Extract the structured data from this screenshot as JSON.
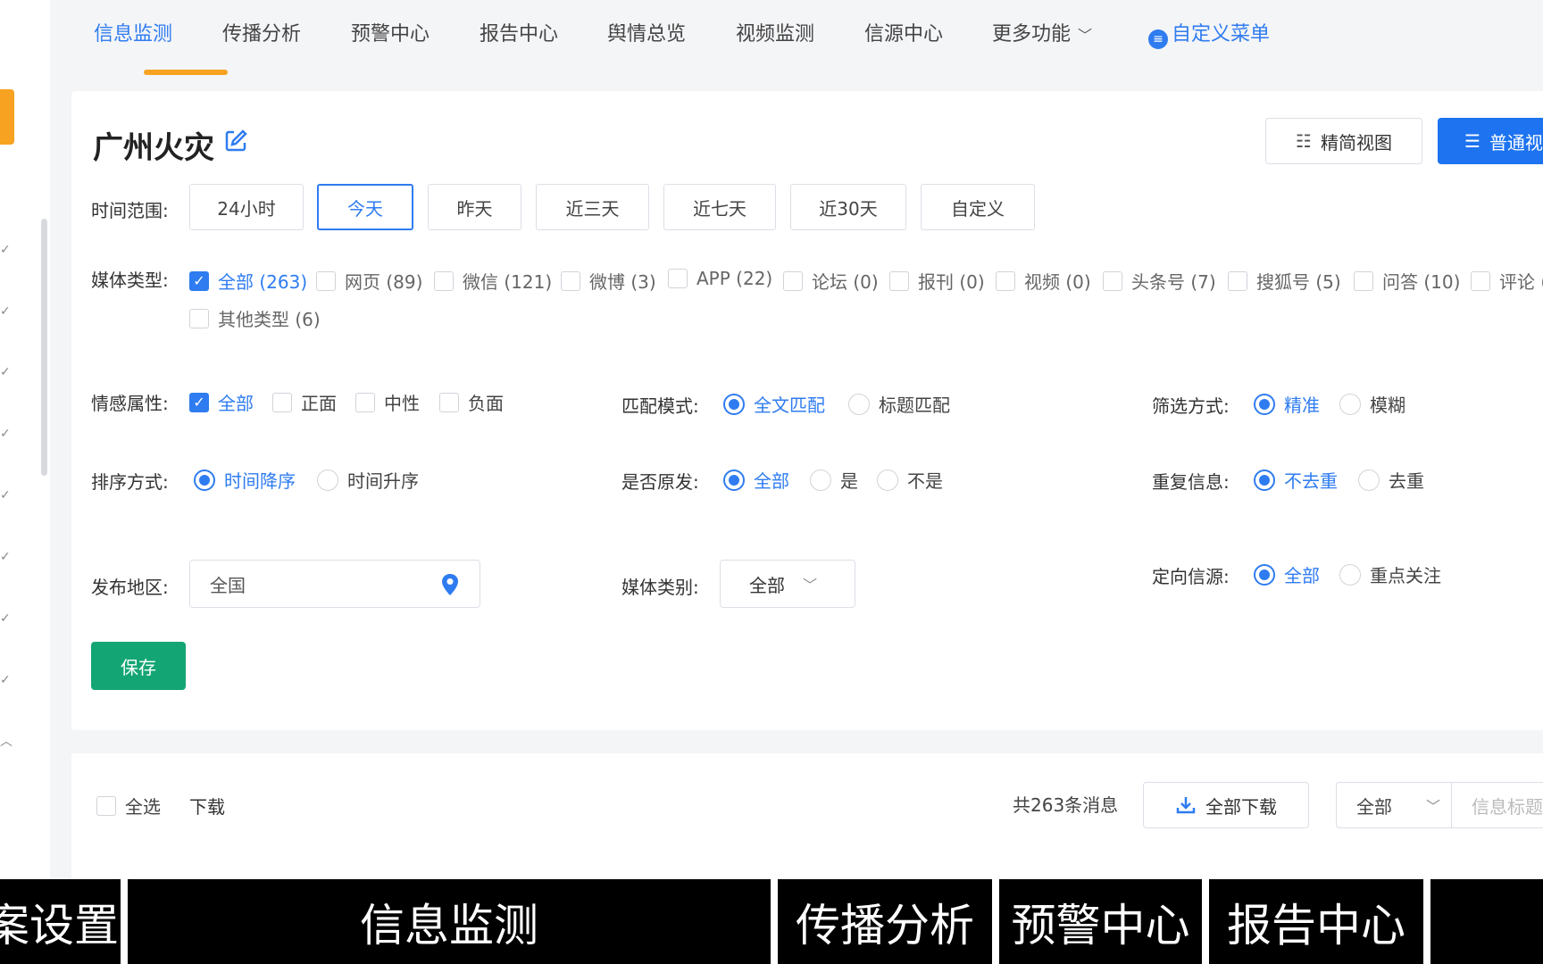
{
  "nav": {
    "items": [
      "信息监测",
      "传播分析",
      "预警中心",
      "报告中心",
      "舆情总览",
      "视频监测",
      "信源中心",
      "更多功能"
    ],
    "custom_menu": "自定义菜单",
    "custom_menu_icon": "list-circle-icon",
    "more_icon": "chevron-down-icon"
  },
  "page": {
    "title": "广州火灾",
    "edit_icon": "edit-icon",
    "view_simple": "精简视图",
    "view_normal": "普通视"
  },
  "time_range": {
    "label": "时间范围:",
    "options": [
      "24小时",
      "今天",
      "昨天",
      "近三天",
      "近七天",
      "近30天",
      "自定义"
    ],
    "selected": "今天"
  },
  "media_type": {
    "label": "媒体类型:",
    "options": [
      {
        "label": "全部 (263)",
        "checked": true
      },
      {
        "label": "网页 (89)",
        "checked": false
      },
      {
        "label": "微信 (121)",
        "checked": false
      },
      {
        "label": "微博 (3)",
        "checked": false
      },
      {
        "label": "APP (22)",
        "checked": false
      },
      {
        "label": "论坛 (0)",
        "checked": false
      },
      {
        "label": "报刊 (0)",
        "checked": false
      },
      {
        "label": "视频 (0)",
        "checked": false
      },
      {
        "label": "头条号 (7)",
        "checked": false
      },
      {
        "label": "搜狐号 (5)",
        "checked": false
      },
      {
        "label": "问答 (10)",
        "checked": false
      },
      {
        "label": "评论 (",
        "checked": false
      },
      {
        "label": "其他类型 (6)",
        "checked": false
      }
    ]
  },
  "sentiment": {
    "label": "情感属性:",
    "options": [
      {
        "label": "全部",
        "checked": true
      },
      {
        "label": "正面",
        "checked": false
      },
      {
        "label": "中性",
        "checked": false
      },
      {
        "label": "负面",
        "checked": false
      }
    ]
  },
  "match_mode": {
    "label": "匹配模式:",
    "options": [
      "全文匹配",
      "标题匹配"
    ],
    "selected": "全文匹配"
  },
  "filter_mode": {
    "label": "筛选方式:",
    "options": [
      "精准",
      "模糊"
    ],
    "selected": "精准"
  },
  "sort": {
    "label": "排序方式:",
    "options": [
      "时间降序",
      "时间升序"
    ],
    "selected": "时间降序"
  },
  "original": {
    "label": "是否原发:",
    "options": [
      "全部",
      "是",
      "不是"
    ],
    "selected": "全部"
  },
  "duplicate": {
    "label": "重复信息:",
    "options": [
      "不去重",
      "去重"
    ],
    "selected": "不去重"
  },
  "region": {
    "label": "发布地区:",
    "value": "全国",
    "icon": "location-pin-icon"
  },
  "media_category": {
    "label": "媒体类别:",
    "value": "全部"
  },
  "directed_source": {
    "label": "定向信源:",
    "options": [
      "全部",
      "重点关注"
    ],
    "selected": "全部"
  },
  "save_label": "保存",
  "list_toolbar": {
    "select_all": "全选",
    "download": "下载",
    "total": "共263条消息",
    "download_all": "全部下载",
    "scope_select": "全部",
    "search_placeholder": "信息标题"
  },
  "subtitles": [
    "案设置",
    "信息监测",
    "传播分析",
    "预警中心",
    "报告中心"
  ],
  "colors": {
    "accent": "#2f7cf0",
    "nav_underline": "#f7a321",
    "save": "#14a574",
    "primary_button": "#1d73f0"
  }
}
